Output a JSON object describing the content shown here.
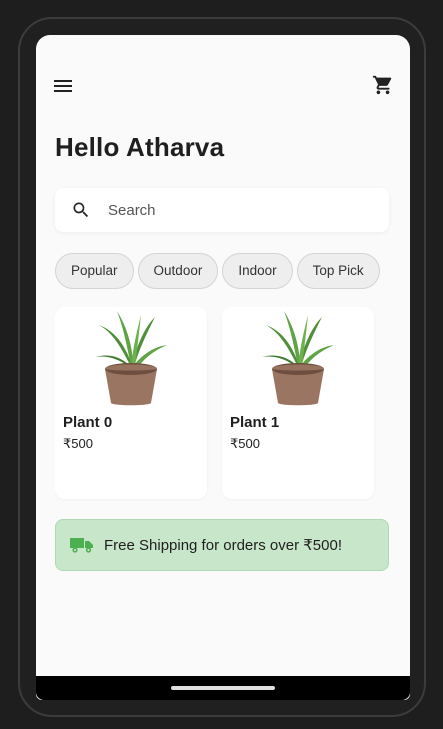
{
  "header": {
    "menu_icon": "menu-icon",
    "cart_icon": "cart-icon"
  },
  "greeting": "Hello Atharva",
  "search": {
    "placeholder": "Search",
    "icon": "search-icon"
  },
  "categories": [
    "Popular",
    "Outdoor",
    "Indoor",
    "Top Pick"
  ],
  "products": [
    {
      "name": "Plant 0",
      "price": "₹500"
    },
    {
      "name": "Plant 1",
      "price": "₹500"
    }
  ],
  "banner": {
    "icon": "truck-icon",
    "text": "Free Shipping for orders over ₹500!"
  },
  "colors": {
    "banner_bg": "#c8e6c9",
    "truck_icon": "#4caf50",
    "chip_bg": "#eeeeee"
  }
}
